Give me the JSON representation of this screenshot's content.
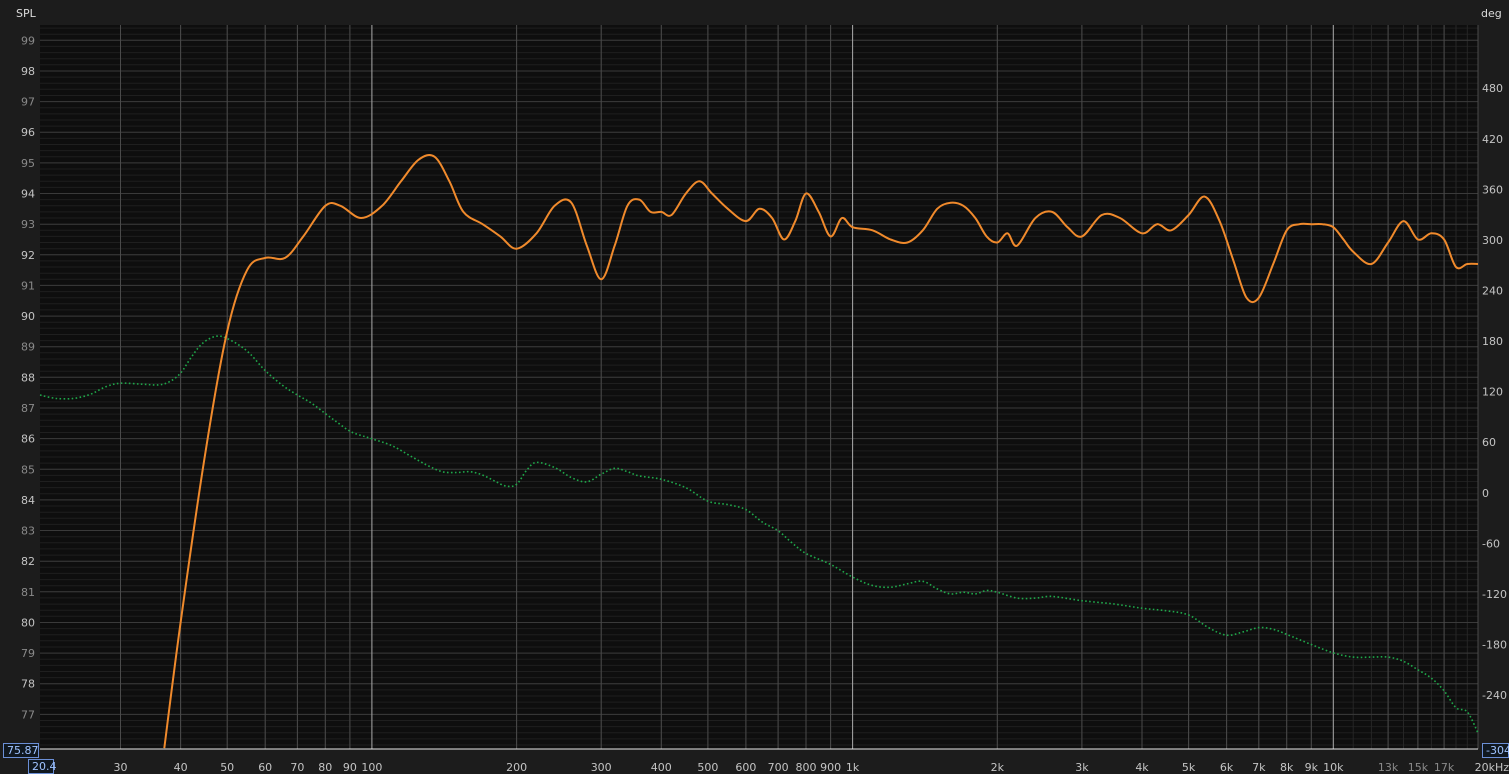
{
  "chart_data": {
    "type": "line",
    "title": "",
    "ylabel": "SPL",
    "y2label": "deg",
    "xunit": "kHz",
    "xscale": "log",
    "xlim": [
      20.4,
      20000
    ],
    "ylim": [
      75.87,
      99.5
    ],
    "y2lim": [
      -304,
      555
    ],
    "grid": true,
    "readouts": {
      "left_bottom": "75.87",
      "x_start": "20.4",
      "right_bottom": "-304"
    },
    "x_ticks": [
      {
        "v": 30,
        "label": "30"
      },
      {
        "v": 40,
        "label": "40"
      },
      {
        "v": 50,
        "label": "50"
      },
      {
        "v": 60,
        "label": "60"
      },
      {
        "v": 70,
        "label": "70"
      },
      {
        "v": 80,
        "label": "80"
      },
      {
        "v": 90,
        "label": "90"
      },
      {
        "v": 100,
        "label": "100"
      },
      {
        "v": 200,
        "label": "200"
      },
      {
        "v": 300,
        "label": "300"
      },
      {
        "v": 400,
        "label": "400"
      },
      {
        "v": 500,
        "label": "500"
      },
      {
        "v": 600,
        "label": "600"
      },
      {
        "v": 700,
        "label": "700"
      },
      {
        "v": 800,
        "label": "800"
      },
      {
        "v": 900,
        "label": "900"
      },
      {
        "v": 1000,
        "label": "1k"
      },
      {
        "v": 2000,
        "label": "2k"
      },
      {
        "v": 3000,
        "label": "3k"
      },
      {
        "v": 4000,
        "label": "4k"
      },
      {
        "v": 5000,
        "label": "5k"
      },
      {
        "v": 6000,
        "label": "6k"
      },
      {
        "v": 7000,
        "label": "7k"
      },
      {
        "v": 8000,
        "label": "8k"
      },
      {
        "v": 9000,
        "label": "9k"
      },
      {
        "v": 10000,
        "label": "10k"
      },
      {
        "v": 13000,
        "label": "13k"
      },
      {
        "v": 15000,
        "label": "15k"
      },
      {
        "v": 17000,
        "label": "17k"
      },
      {
        "v": 20000,
        "label": "20kHz"
      }
    ],
    "y_ticks": [
      77,
      78,
      79,
      80,
      81,
      82,
      83,
      84,
      85,
      86,
      87,
      88,
      89,
      90,
      91,
      92,
      93,
      94,
      95,
      96,
      97,
      98,
      99
    ],
    "y2_ticks": [
      480,
      420,
      360,
      300,
      240,
      180,
      120,
      60,
      0,
      -60,
      -120,
      -180,
      -240
    ],
    "series": [
      {
        "axis": "left",
        "color": "#f08a2c",
        "style": "solid",
        "x": [
          37,
          40,
          45,
          50,
          55,
          60,
          66,
          72,
          80,
          86,
          95,
          105,
          115,
          125,
          135,
          145,
          155,
          170,
          185,
          200,
          220,
          240,
          260,
          280,
          300,
          320,
          340,
          360,
          380,
          400,
          420,
          450,
          480,
          510,
          550,
          600,
          640,
          680,
          720,
          760,
          800,
          850,
          900,
          950,
          1000,
          1100,
          1200,
          1300,
          1400,
          1500,
          1600,
          1700,
          1800,
          1900,
          2000,
          2100,
          2200,
          2400,
          2600,
          2800,
          3000,
          3300,
          3600,
          4000,
          4300,
          4600,
          5000,
          5400,
          5800,
          6200,
          6600,
          7000,
          7500,
          8000,
          8500,
          9000,
          9500,
          10000,
          10500,
          11000,
          12000,
          13000,
          14000,
          15000,
          16000,
          17000,
          18000,
          19000,
          20000
        ],
        "y": [
          75.9,
          80.0,
          85.5,
          89.5,
          91.5,
          91.9,
          91.9,
          92.6,
          93.6,
          93.6,
          93.2,
          93.6,
          94.4,
          95.1,
          95.2,
          94.4,
          93.4,
          93.0,
          92.6,
          92.2,
          92.7,
          93.6,
          93.7,
          92.3,
          91.2,
          92.3,
          93.6,
          93.8,
          93.4,
          93.4,
          93.3,
          94.0,
          94.4,
          94.0,
          93.5,
          93.1,
          93.5,
          93.2,
          92.5,
          93.1,
          94.0,
          93.4,
          92.6,
          93.2,
          92.9,
          92.8,
          92.5,
          92.4,
          92.8,
          93.5,
          93.7,
          93.6,
          93.2,
          92.6,
          92.4,
          92.7,
          92.3,
          93.2,
          93.4,
          92.9,
          92.6,
          93.3,
          93.2,
          92.7,
          93.0,
          92.8,
          93.3,
          93.9,
          93.1,
          91.8,
          90.6,
          90.6,
          91.7,
          92.8,
          93.0,
          93.0,
          93.0,
          92.9,
          92.5,
          92.1,
          91.7,
          92.4,
          93.1,
          92.5,
          92.7,
          92.5,
          91.6,
          91.7,
          91.7
        ]
      },
      {
        "axis": "right",
        "color": "#1fa84a",
        "style": "dotted",
        "x": [
          20.4,
          22,
          24,
          26,
          28,
          30,
          33,
          36,
          38,
          40,
          42,
          44,
          46,
          48,
          50,
          53,
          56,
          60,
          65,
          70,
          75,
          80,
          85,
          90,
          95,
          100,
          110,
          120,
          130,
          140,
          150,
          160,
          170,
          180,
          190,
          200,
          210,
          220,
          240,
          260,
          280,
          300,
          320,
          340,
          360,
          400,
          450,
          500,
          550,
          600,
          650,
          700,
          750,
          800,
          900,
          1000,
          1100,
          1200,
          1300,
          1400,
          1500,
          1600,
          1700,
          1800,
          1900,
          2000,
          2200,
          2400,
          2600,
          3000,
          3500,
          4000,
          4500,
          5000,
          5500,
          6000,
          6500,
          7000,
          7500,
          8000,
          9000,
          10000,
          11000,
          12000,
          13000,
          14000,
          15000,
          16000,
          17000,
          18000,
          19000,
          20000
        ],
        "y": [
          116,
          112,
          112,
          117,
          126,
          130,
          129,
          128,
          132,
          142,
          160,
          175,
          183,
          186,
          183,
          175,
          164,
          145,
          128,
          116,
          106,
          94,
          83,
          73,
          68,
          64,
          56,
          44,
          33,
          25,
          24,
          25,
          21,
          14,
          8,
          10,
          27,
          36,
          30,
          18,
          13,
          22,
          29,
          25,
          20,
          16,
          6,
          -10,
          -14,
          -20,
          -35,
          -45,
          -60,
          -72,
          -85,
          -100,
          -110,
          -112,
          -108,
          -105,
          -114,
          -120,
          -118,
          -120,
          -116,
          -118,
          -125,
          -125,
          -123,
          -128,
          -132,
          -137,
          -140,
          -145,
          -160,
          -169,
          -165,
          -160,
          -162,
          -168,
          -180,
          -190,
          -195,
          -195,
          -195,
          -200,
          -210,
          -220,
          -235,
          -255,
          -260,
          -285
        ]
      }
    ]
  }
}
